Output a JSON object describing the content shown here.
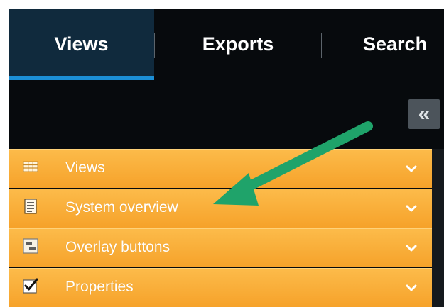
{
  "tabs": [
    {
      "label": "Views",
      "active": true
    },
    {
      "label": "Exports",
      "active": false
    },
    {
      "label": "Search",
      "active": false
    }
  ],
  "collapse_button": {
    "glyph": "«",
    "icon": "double-chevron-left-icon"
  },
  "panels": [
    {
      "label": "Views",
      "icon": "grid-icon"
    },
    {
      "label": "System overview",
      "icon": "document-list-icon"
    },
    {
      "label": "Overlay buttons",
      "icon": "overlay-icon"
    },
    {
      "label": "Properties",
      "icon": "checkbox-checked-icon"
    }
  ],
  "colors": {
    "accent": "#1c8fd6",
    "panel_orange": "#f6a22a",
    "annotation_arrow": "#1fa36a",
    "background": "#070a0d"
  }
}
